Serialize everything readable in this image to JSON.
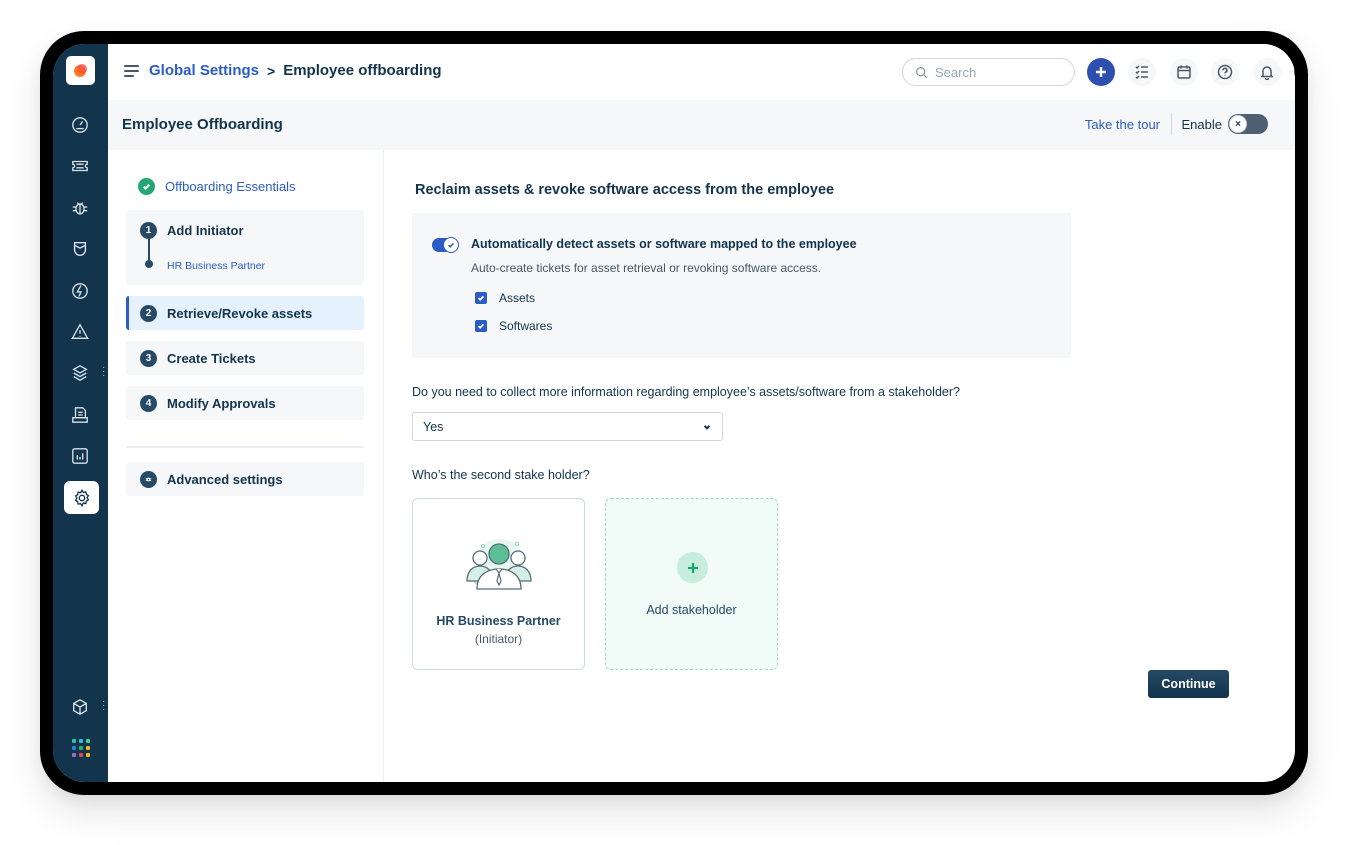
{
  "header": {
    "breadcrumb": {
      "parent": "Global Settings",
      "separator": ">",
      "current": "Employee offboarding"
    },
    "search_placeholder": "Search",
    "actions": [
      "add-icon",
      "checklist-icon",
      "calendar-icon",
      "help-icon",
      "notification-bell-icon"
    ]
  },
  "subheader": {
    "title": "Employee Offboarding",
    "tour_link": "Take the tour",
    "enable_label": "Enable",
    "enable_state": false,
    "enable_knob_glyph": "×"
  },
  "sidebar_nav": {
    "icons": [
      "dashboard-icon",
      "tickets-icon",
      "problems-icon",
      "changes-icon",
      "releases-icon",
      "alerts-icon",
      "assets-icon",
      "solutions-icon",
      "reports-icon",
      "settings-icon"
    ],
    "active": "settings-icon",
    "bottom_icons": [
      "cube-icon",
      "apps-grid-icon"
    ],
    "apps_grid_colors": [
      "#2ec4a0",
      "#35b8e0",
      "#3dd68c",
      "#2f7fd8",
      "#27b36a",
      "#f2b416",
      "#a86bc8",
      "#e5483e",
      "#f2b416"
    ]
  },
  "steps": {
    "essentials": {
      "label": "Offboarding Essentials",
      "done": true
    },
    "items": [
      {
        "number": "1",
        "label": "Add Initiator",
        "sub": "HR Business Partner"
      },
      {
        "number": "2",
        "label": "Retrieve/Revoke assets",
        "active": true
      },
      {
        "number": "3",
        "label": "Create Tickets"
      },
      {
        "number": "4",
        "label": "Modify Approvals"
      }
    ],
    "advanced": {
      "label": "Advanced settings"
    }
  },
  "main": {
    "title": "Reclaim assets & revoke software access from the employee",
    "auto_detect": {
      "enabled": true,
      "title": "Automatically detect assets or software mapped to the employee",
      "description": "Auto-create tickets for asset retrieval or revoking software access.",
      "options": [
        {
          "label": "Assets",
          "checked": true
        },
        {
          "label": "Softwares",
          "checked": true
        }
      ]
    },
    "question": "Do you need to collect more information regarding employee’s assets/software from a stakeholder?",
    "answer": "Yes",
    "second_question": "Who’s the second stake holder?",
    "stakeholders": [
      {
        "name": "HR Business Partner",
        "role": "(Initiator)"
      }
    ],
    "add_stakeholder_label": "Add stakeholder",
    "continue_label": "Continue"
  },
  "colors": {
    "primary_nav": "#12344d",
    "accent_blue": "#2c5cc5",
    "success_green": "#24a676"
  }
}
